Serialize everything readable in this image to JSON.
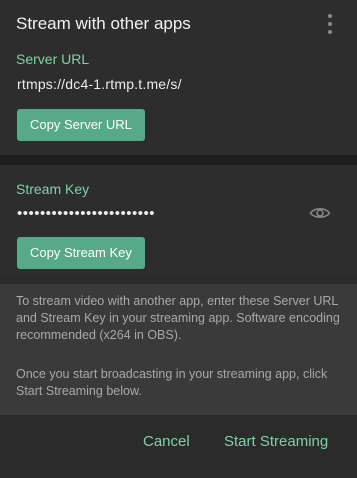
{
  "dialog": {
    "title": "Stream with other apps",
    "menu_icon": "kebab-menu-icon"
  },
  "server": {
    "label": "Server URL",
    "value": "rtmps://dc4-1.rtmp.t.me/s/",
    "copy_button": "Copy Server URL"
  },
  "stream_key": {
    "label": "Stream Key",
    "masked_value": "••••••••••••••••••••••••",
    "reveal_icon": "eye-icon",
    "copy_button": "Copy Stream Key"
  },
  "info": {
    "paragraph1": "To stream video with another app, enter these Server URL and Stream Key in your streaming app. Software encoding recommended (x264 in OBS).",
    "paragraph2": "Once you start broadcasting in your streaming app, click Start Streaming below."
  },
  "footer": {
    "cancel_label": "Cancel",
    "start_label": "Start Streaming"
  },
  "colors": {
    "accent": "#7dd2a6",
    "button": "#56ab86",
    "background": "#2b2b2b",
    "info_background": "#3a3a3a"
  }
}
